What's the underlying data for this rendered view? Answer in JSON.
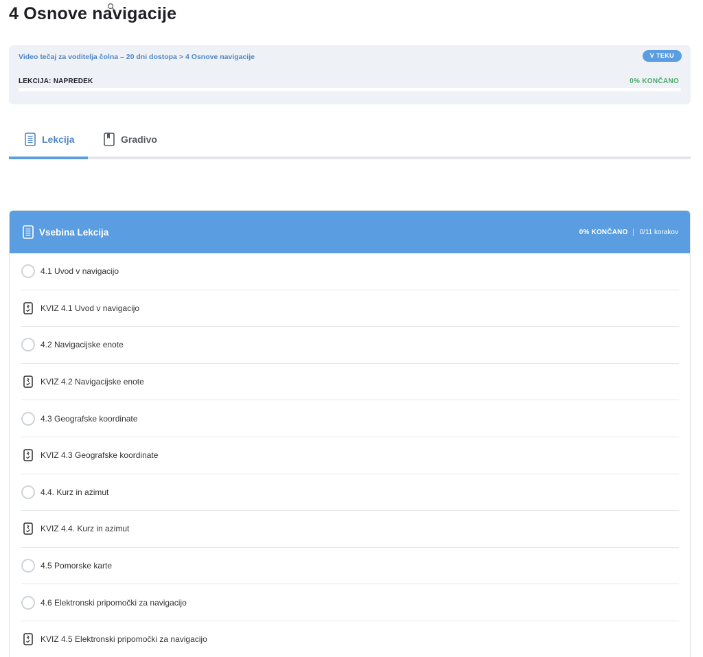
{
  "page": {
    "title": "4 Osnove navigacije"
  },
  "status": {
    "breadcrumb": {
      "course": "Video tečaj za voditelja čolna – 20 dni dostopa",
      "separator": ">",
      "current": "4 Osnove navigacije"
    },
    "badge": "V TEKU",
    "progress_label": "LEKCIJA: NAPREDEK",
    "progress_percent_text": "0% KONČANO",
    "progress_fraction": 0
  },
  "tabs": [
    {
      "label": "Lekcija",
      "icon": "document-icon",
      "active": true
    },
    {
      "label": "Gradivo",
      "icon": "bookmark-icon",
      "active": false
    }
  ],
  "panel": {
    "title": "Vsebina Lekcija",
    "percent": "0% KONČANO",
    "steps": "0/11 korakov",
    "items": [
      {
        "label": "4.1 Uvod v navigacijo",
        "type": "topic"
      },
      {
        "label": "KVIZ 4.1 Uvod v navigacijo",
        "type": "quiz"
      },
      {
        "label": "4.2 Navigacijske enote",
        "type": "topic"
      },
      {
        "label": "KVIZ 4.2 Navigacijske enote",
        "type": "quiz"
      },
      {
        "label": "4.3 Geografske koordinate",
        "type": "topic"
      },
      {
        "label": "KVIZ 4.3 Geografske koordinate",
        "type": "quiz"
      },
      {
        "label": "4.4. Kurz in azimut",
        "type": "topic"
      },
      {
        "label": "KVIZ 4.4. Kurz in azimut",
        "type": "quiz"
      },
      {
        "label": "4.5 Pomorske karte",
        "type": "topic"
      },
      {
        "label": "4.6 Elektronski pripomočki za navigacijo",
        "type": "topic"
      },
      {
        "label": "KVIZ 4.5 Elektronski pripomočki za navigacijo",
        "type": "quiz"
      }
    ]
  },
  "colors": {
    "accent": "#5a9de0",
    "link": "#4f86c6",
    "success": "#4caa6d",
    "card_bg": "#eef1f6"
  }
}
